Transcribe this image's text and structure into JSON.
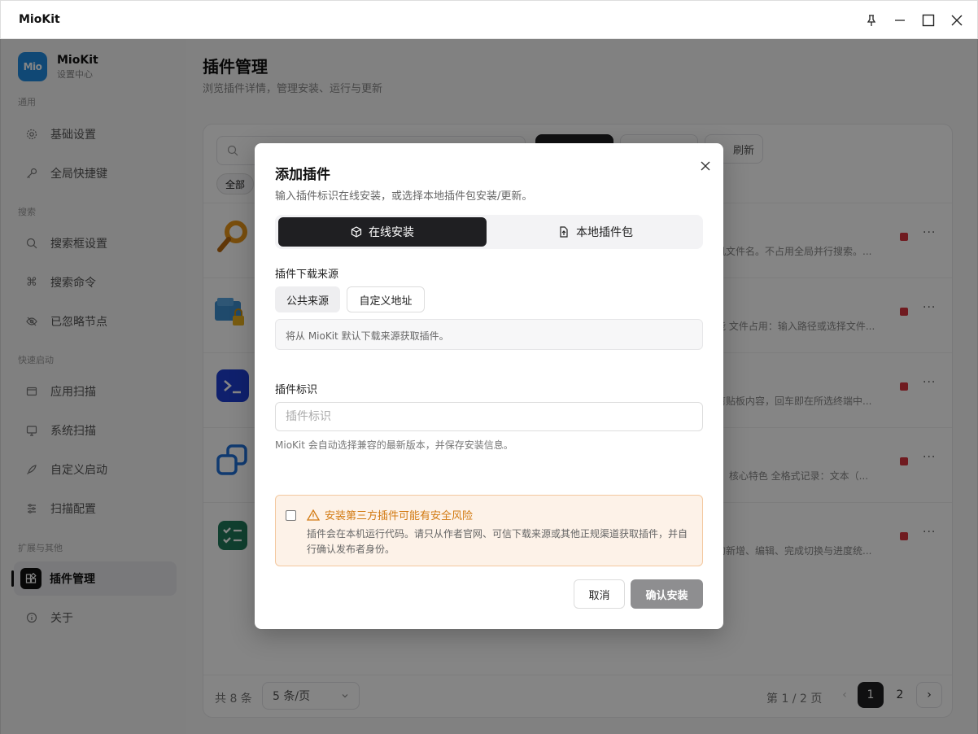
{
  "window": {
    "title": "MioKit"
  },
  "brand": {
    "logo_text": "Mio",
    "name": "MioKit",
    "subtitle": "设置中心"
  },
  "sidebar": {
    "sections": [
      {
        "label": "通用"
      },
      {
        "label": "搜索"
      },
      {
        "label": "快速启动"
      },
      {
        "label": "扩展与其他"
      }
    ],
    "items": [
      {
        "label": "基础设置",
        "icon": "gear-icon"
      },
      {
        "label": "全局快捷键",
        "icon": "key-icon"
      },
      {
        "label": "搜索框设置",
        "icon": "search-icon"
      },
      {
        "label": "搜索命令",
        "icon": "command-icon"
      },
      {
        "label": "已忽略节点",
        "icon": "eye-off-icon"
      },
      {
        "label": "应用扫描",
        "icon": "window-icon"
      },
      {
        "label": "系统扫描",
        "icon": "monitor-icon"
      },
      {
        "label": "自定义启动",
        "icon": "rocket-icon"
      },
      {
        "label": "扫描配置",
        "icon": "sliders-icon"
      },
      {
        "label": "插件管理",
        "icon": "plugin-icon",
        "active": true
      },
      {
        "label": "关于",
        "icon": "info-icon"
      }
    ]
  },
  "page": {
    "title": "插件管理",
    "subtitle": "浏览插件详情，管理安装、运行与更新"
  },
  "toolbar": {
    "refresh_label": "刷新",
    "filter_chip": "全部"
  },
  "plugins": [
    {
      "desc": "机文件名。不占用全局并行搜索。..."
    },
    {
      "desc": "能 文件占用：输入路径或选择文件..."
    },
    {
      "desc": "剪贴板内容，回车即在所选终端中..."
    },
    {
      "desc": "。 核心特色 全格式记录：文本（..."
    },
    {
      "desc": "的新增、编辑、完成切换与进度统..."
    }
  ],
  "pagination": {
    "total": "共 8 条",
    "per_page": "5 条/页",
    "page_info": "第 1 / 2 页",
    "pages": [
      "1",
      "2"
    ]
  },
  "dialog": {
    "title": "添加插件",
    "subtitle": "输入插件标识在线安装，或选择本地插件包安装/更新。",
    "tabs": {
      "online": "在线安装",
      "local": "本地插件包"
    },
    "source_label": "插件下载来源",
    "source_public": "公共来源",
    "source_custom": "自定义地址",
    "source_note": "将从 MioKit 默认下载来源获取插件。",
    "id_label": "插件标识",
    "id_placeholder": "插件标识",
    "id_value": "",
    "id_hint": "MioKit 会自动选择兼容的最新版本，并保存安装信息。",
    "warning_title": "安装第三方插件可能有安全风险",
    "warning_body": "插件会在本机运行代码。请只从作者官网、可信下载来源或其他正规渠道获取插件，并自行确认发布者身份。",
    "cancel": "取消",
    "confirm": "确认安装"
  }
}
